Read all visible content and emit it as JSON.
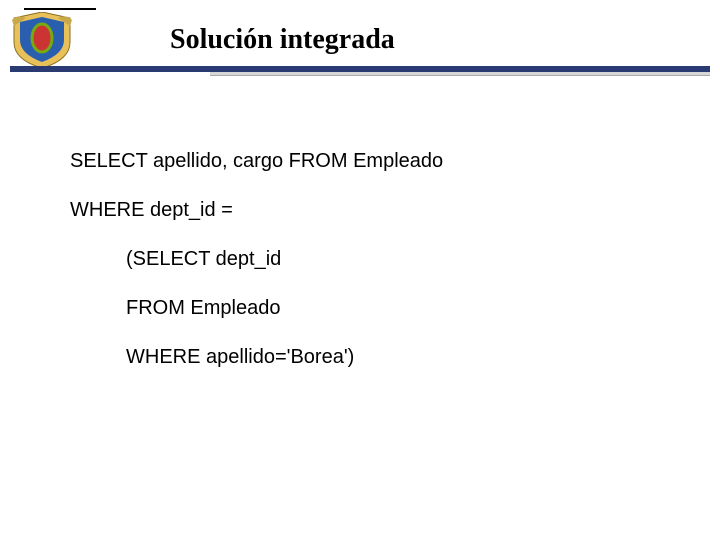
{
  "header": {
    "title": "Solución integrada"
  },
  "code": {
    "l1": "SELECT apellido, cargo FROM Empleado",
    "l2": "WHERE dept_id =",
    "l3": "(SELECT dept_id",
    "l4": "FROM Empleado",
    "l5": "WHERE apellido='Borea')"
  }
}
